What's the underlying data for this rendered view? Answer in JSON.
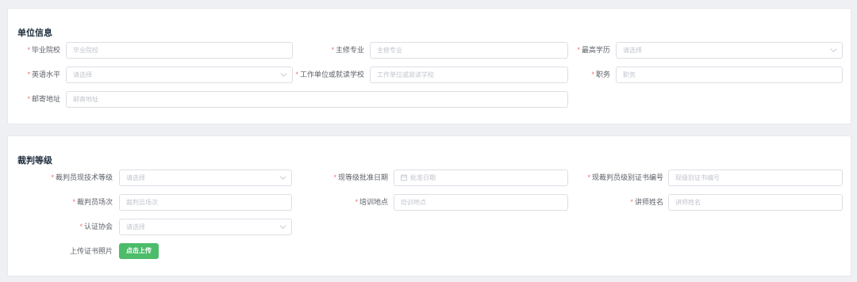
{
  "unit": {
    "title": "单位信息",
    "fields": {
      "school": {
        "label": "毕业院校",
        "placeholder": "毕业院校",
        "required": true
      },
      "major": {
        "label": "主修专业",
        "placeholder": "主修专业",
        "required": true
      },
      "education": {
        "label": "最高学历",
        "placeholder": "请选择",
        "required": true
      },
      "english": {
        "label": "英语水平",
        "placeholder": "请选择",
        "required": true
      },
      "workplace": {
        "label": "工作单位或就读学校",
        "placeholder": "工作单位或就读学校",
        "required": true
      },
      "position": {
        "label": "职务",
        "placeholder": "职务",
        "required": true
      },
      "address": {
        "label": "邮寄地址",
        "placeholder": "邮寄地址",
        "required": true
      }
    }
  },
  "referee": {
    "title": "裁判等级",
    "fields": {
      "tech_level": {
        "label": "裁判员现技术等级",
        "placeholder": "请选择",
        "required": true
      },
      "approval_date": {
        "label": "现等级批准日期",
        "placeholder": "批准日期",
        "required": true
      },
      "cert_no": {
        "label": "现裁判员级别证书编号",
        "placeholder": "现级别证书编号",
        "required": true
      },
      "sessions": {
        "label": "裁判员场次",
        "placeholder": "裁判员场次",
        "required": true
      },
      "training_place": {
        "label": "培训地点",
        "placeholder": "培训地点",
        "required": true
      },
      "lecturer": {
        "label": "讲师姓名",
        "placeholder": "讲师姓名",
        "required": true
      },
      "association": {
        "label": "认证协会",
        "placeholder": "请选择",
        "required": true
      },
      "upload": {
        "label": "上传证书照片",
        "button": "点击上传",
        "required": false
      }
    }
  },
  "colors": {
    "required_star": "#f56c6c",
    "upload_button": "#4cbc6b"
  }
}
